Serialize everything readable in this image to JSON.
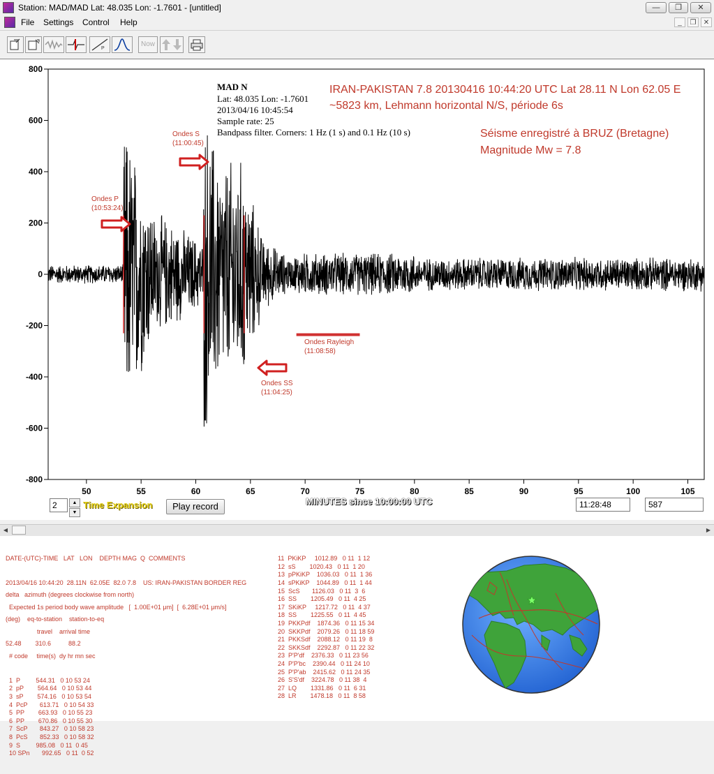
{
  "window": {
    "title": "Station: MAD/MAD Lat: 48.035 Lon: -1.7601 - [untitled]"
  },
  "menu": [
    "File",
    "Settings",
    "Control",
    "Help"
  ],
  "toolbar": {
    "now_label": "Now"
  },
  "plot": {
    "header": {
      "station": "MAD  N",
      "latlon": "Lat: 48.035 Lon: -1.7601",
      "datetime": "2013/04/16 10:45:54",
      "sample_rate": "Sample rate: 25",
      "filter": "Bandpass filter. Corners: 1 Hz (1 s) and 0.1 Hz (10 s)"
    },
    "event_line1": "IRAN-PAKISTAN 7.8 20130416 10:44:20 UTC Lat 28.11 N Lon 62.05 E",
    "event_line2": "~5823 km, Lehmann horizontal N/S, période 6s",
    "event_line3": "Séisme enregistré à BRUZ (Bretagne)",
    "event_line4": "Magnitude Mw = 7.8",
    "annotations": {
      "p_label": "Ondes P",
      "p_time": "(10:53:24)",
      "s_label": "Ondes S",
      "s_time": "(11:00:45)",
      "ss_label": "Ondes SS",
      "ss_time": "(11:04:25)",
      "rayleigh_label": "Ondes Rayleigh",
      "rayleigh_time": "(11:08:58)"
    },
    "x_axis_label": "MINUTES since 10:00:00 UTC"
  },
  "chart_data": {
    "type": "line",
    "xlim": [
      46.5,
      106.5
    ],
    "ylim": [
      -800,
      800
    ],
    "xticks": [
      50,
      55,
      60,
      65,
      70,
      75,
      80,
      85,
      90,
      95,
      100,
      105
    ],
    "yticks": [
      800,
      600,
      400,
      200,
      0,
      -200,
      -400,
      -600,
      -800
    ],
    "phase_markers_minutes": [
      53.4,
      60.75,
      64.42
    ],
    "rayleigh_span_minutes": [
      69.2,
      75.0
    ]
  },
  "controls": {
    "expansion_value": "2",
    "expansion_label": "Time Expansion",
    "play_label": "Play record",
    "clock_value": "11:28:48",
    "count_value": "587"
  },
  "info_left": {
    "header": "DATE-(UTC)-TIME   LAT   LON    DEPTH MAG  Q  COMMENTS",
    "event": "2013/04/16 10:44:20  28.11N  62.05E  82.0 7.8    US: IRAN-PAKISTAN BORDER REG",
    "amplitude": "  Expected 1s period body wave amplitude   [  1.00E+01 μm]  [  6.28E+01 μm/s]",
    "delta_header": "delta   azimuth (degrees clockwise from north)",
    "delta_sub": "(deg)    eq-to-station    station-to-eq",
    "delta_values": "52.48        310.6          88.2",
    "travel_header": "                  travel    arrival time",
    "code_header": "  # code     time(s)  dy hr mn sec",
    "rows": [
      "  1  P         544.31   0 10 53 24",
      "  2  pP        564.64   0 10 53 44",
      "  3  sP        574.16   0 10 53 54",
      "  4  PcP       613.71   0 10 54 33",
      "  5  PP        663.93   0 10 55 23",
      "  6  PP        670.86   0 10 55 30",
      "  7  ScP       843.27   0 10 58 23",
      "  8  PcS       852.33   0 10 58 32",
      "  9  S         985.08   0 11  0 45",
      "  10 SPn       992.65   0 11  0 52"
    ]
  },
  "info_mid": {
    "rows": [
      "11  PKiKP     1012.89   0 11  1 12",
      "12  sS        1020.43   0 11  1 20",
      "13  pPKiKP    1036.03   0 11  1 36",
      "14  sPKiKP    1044.89   0 11  1 44",
      "15  ScS       1126.03   0 11  3  6",
      "16  SS        1205.49   0 11  4 25",
      "17  SKiKP     1217.72   0 11  4 37",
      "18  SS        1225.55   0 11  4 45",
      "19  PKKPdf    1874.36   0 11 15 34",
      "20  SKKPdf    2079.26   0 11 18 59",
      "21  PKKSdf    2088.12   0 11 19  8",
      "22  SKKSdf    2292.87   0 11 22 32",
      "23  P'P'df    2376.33   0 11 23 56",
      "24  P'P'bc    2390.44   0 11 24 10",
      "25  P'P'ab    2415.62   0 11 24 35",
      "26  S'S'df    3224.78   0 11 38  4",
      "27  LQ        1331.86   0 11  6 31",
      "28  LR        1478.18   0 11  8 58"
    ]
  }
}
